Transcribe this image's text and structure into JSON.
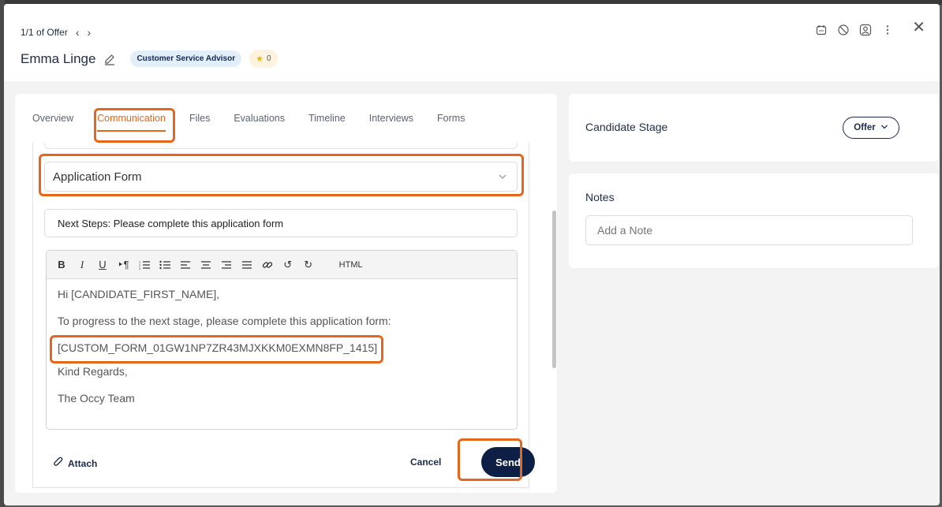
{
  "header": {
    "pager_text": "1/1 of Offer",
    "candidate_name": "Emma Linge",
    "role_badge": "Customer Service Advisor",
    "rating": "0",
    "icons": [
      "calendar-icon",
      "block-icon",
      "user-circle-icon",
      "more-vertical-icon",
      "close-icon"
    ]
  },
  "tabs": [
    {
      "label": "Overview"
    },
    {
      "label": "Communication"
    },
    {
      "label": "Files"
    },
    {
      "label": "Evaluations"
    },
    {
      "label": "Timeline"
    },
    {
      "label": "Interviews"
    },
    {
      "label": "Forms"
    }
  ],
  "active_tab": "Communication",
  "composer": {
    "template_select": "Application Form",
    "subject": "Next Steps: Please complete this application form",
    "toolbar_html_label": "HTML",
    "body": {
      "greeting": "Hi [CANDIDATE_FIRST_NAME],",
      "line1": "To progress to the next stage, please complete this application form:",
      "form_token": "[CUSTOM_FORM_01GW1NP7ZR43MJXKKM0EXMN8FP_1415]",
      "signoff": "Kind Regards,",
      "signature": "The Occy Team"
    },
    "attach_label": "Attach",
    "cancel_label": "Cancel",
    "send_label": "Send"
  },
  "stage_card": {
    "label": "Candidate Stage",
    "value": "Offer"
  },
  "notes_card": {
    "label": "Notes",
    "placeholder": "Add a Note"
  },
  "colors": {
    "accent": "#e4671b",
    "navy": "#0d1f45",
    "badge_bg": "#e3eefb"
  }
}
